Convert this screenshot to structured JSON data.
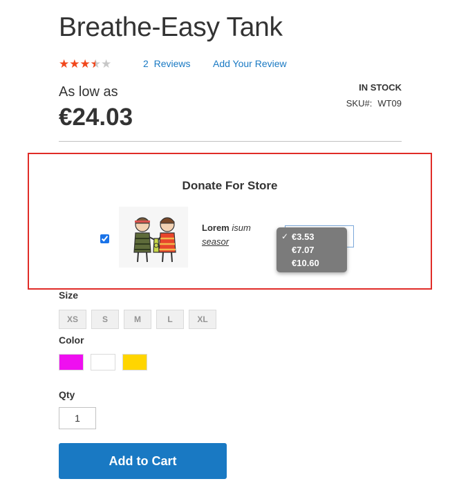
{
  "product": {
    "title": "Breathe-Easy Tank",
    "rating": {
      "value": 3.5,
      "max": 5
    },
    "reviews_count": "2",
    "reviews_label": "Reviews",
    "add_review_label": "Add Your Review",
    "price_prefix": "As low as",
    "price": "€24.03",
    "stock_status": "IN STOCK",
    "sku_label": "SKU#:",
    "sku_value": "WT09"
  },
  "donation": {
    "title": "Donate For Store",
    "checked": true,
    "item_name_bold": "Lorem",
    "item_name_italic": "isum",
    "item_name_link": "seasor",
    "amount_options": [
      {
        "label": "€3.53",
        "selected": true
      },
      {
        "label": "€7.07",
        "selected": false
      },
      {
        "label": "€10.60",
        "selected": false
      }
    ],
    "check_glyph": "✓"
  },
  "options": {
    "size_label": "Size",
    "sizes": [
      "XS",
      "S",
      "M",
      "L",
      "XL"
    ],
    "color_label": "Color",
    "colors": [
      "#ef0ff0",
      "#ffffff",
      "#ffd500"
    ],
    "qty_label": "Qty",
    "qty_value": "1"
  },
  "cart": {
    "add_to_cart_label": "Add to Cart",
    "button_color": "#1979c3"
  },
  "accent_colors": {
    "link": "#1979c3",
    "star": "#f1471c",
    "highlight_border": "#e02b27"
  }
}
